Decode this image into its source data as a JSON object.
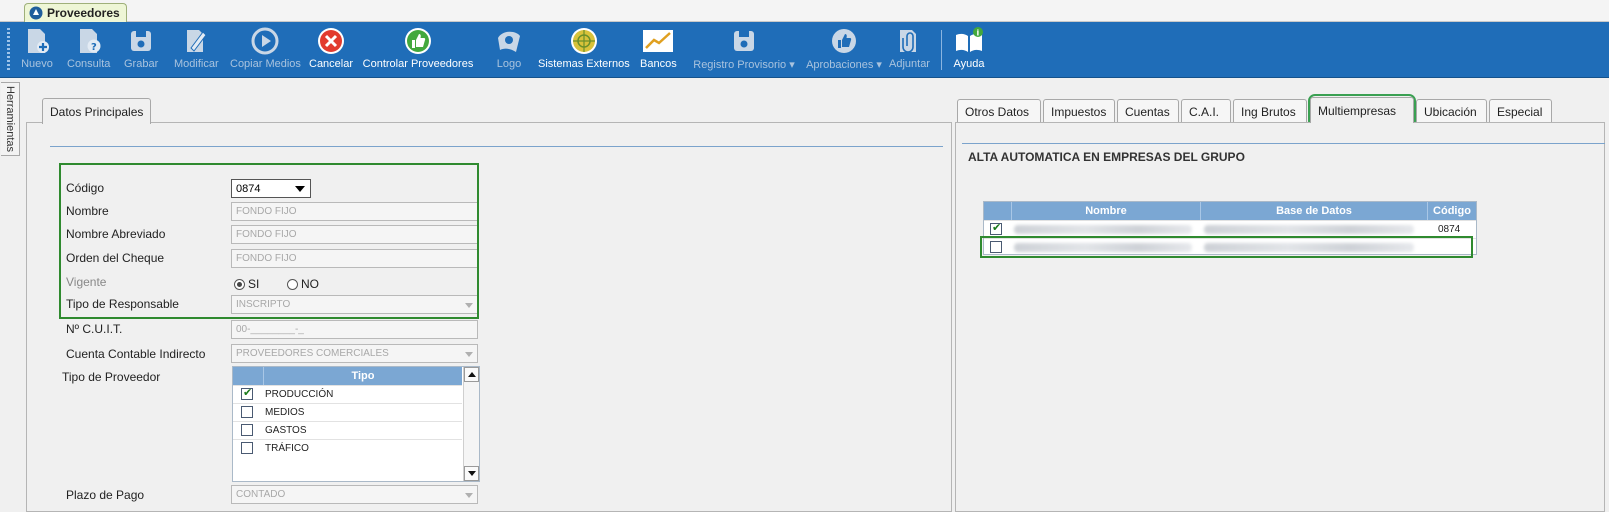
{
  "window": {
    "tab_title": "Proveedores"
  },
  "toolbar": [
    {
      "key": "nuevo",
      "label": "Nuevo",
      "enabled": false,
      "icon": "new-doc-icon"
    },
    {
      "key": "consulta",
      "label": "Consulta",
      "enabled": false,
      "icon": "query-icon"
    },
    {
      "key": "grabar",
      "label": "Grabar",
      "enabled": false,
      "icon": "save-icon"
    },
    {
      "key": "modificar",
      "label": "Modificar",
      "enabled": false,
      "icon": "edit-icon"
    },
    {
      "key": "copiar",
      "label": "Copiar Medios",
      "enabled": false,
      "icon": "play-icon"
    },
    {
      "key": "cancelar",
      "label": "Cancelar",
      "enabled": true,
      "icon": "cancel-icon"
    },
    {
      "key": "controlar",
      "label": "Controlar Proveedores",
      "enabled": true,
      "icon": "thumbs-up-icon"
    },
    {
      "key": "logo",
      "label": "Logo",
      "enabled": false,
      "icon": "logo-icon"
    },
    {
      "key": "sistemas",
      "label": "Sistemas Externos",
      "enabled": true,
      "icon": "globe-icon"
    },
    {
      "key": "bancos",
      "label": "Bancos",
      "enabled": true,
      "icon": "chart-icon"
    },
    {
      "key": "registro",
      "label": "Registro Provisorio ▾",
      "enabled": false,
      "icon": "save-icon"
    },
    {
      "key": "aprobaciones",
      "label": "Aprobaciones ▾",
      "enabled": false,
      "icon": "thumbs-up-icon"
    },
    {
      "key": "adjuntar",
      "label": "Adjuntar",
      "enabled": false,
      "icon": "attach-icon"
    },
    {
      "key": "ayuda",
      "label": "Ayuda",
      "enabled": true,
      "icon": "help-book-icon"
    }
  ],
  "side_tab": "Herramientas",
  "left_tab": "Datos Principales",
  "form": {
    "codigo_label": "Código",
    "codigo_value": "0874",
    "nombre_label": "Nombre",
    "nombre_value": "FONDO FIJO",
    "nombre_abrev_label": "Nombre Abreviado",
    "nombre_abrev_value": "FONDO FIJO",
    "orden_label": "Orden del Cheque",
    "orden_value": "FONDO FIJO",
    "vigente_label": "Vigente",
    "vigente_si": "SI",
    "vigente_no": "NO",
    "tipo_resp_label": "Tipo de Responsable",
    "tipo_resp_value": "INSCRIPTO",
    "cuit_label": "Nº C.U.I.T.",
    "cuit_value": "00-________-_",
    "cuenta_label": "Cuenta Contable Indirecto",
    "cuenta_value": "PROVEEDORES COMERCIALES",
    "tipo_prov_label": "Tipo de Proveedor",
    "plazo_label": "Plazo de Pago",
    "plazo_value": "CONTADO"
  },
  "tipo_grid": {
    "header": "Tipo",
    "rows": [
      {
        "label": "PRODUCCIÓN",
        "checked": true
      },
      {
        "label": "MEDIOS",
        "checked": false
      },
      {
        "label": "GASTOS",
        "checked": false
      },
      {
        "label": "TRÁFICO",
        "checked": false
      }
    ]
  },
  "right_tabs": [
    "Otros Datos",
    "Impuestos",
    "Cuentas",
    "C.A.I.",
    "Ing Brutos",
    "Multiempresas",
    "Ubicación",
    "Especial"
  ],
  "multiempresas": {
    "title": "ALTA AUTOMATICA EN EMPRESAS DEL GRUPO",
    "headers": [
      "Nombre",
      "Base de Datos",
      "Código"
    ],
    "rows": [
      {
        "checked": true,
        "codigo": "0874"
      },
      {
        "checked": false,
        "codigo": ""
      }
    ]
  },
  "colors": {
    "toolbar": "#1f6db8",
    "highlight": "#2f8a2f",
    "grid_header": "#7ba7d3"
  }
}
